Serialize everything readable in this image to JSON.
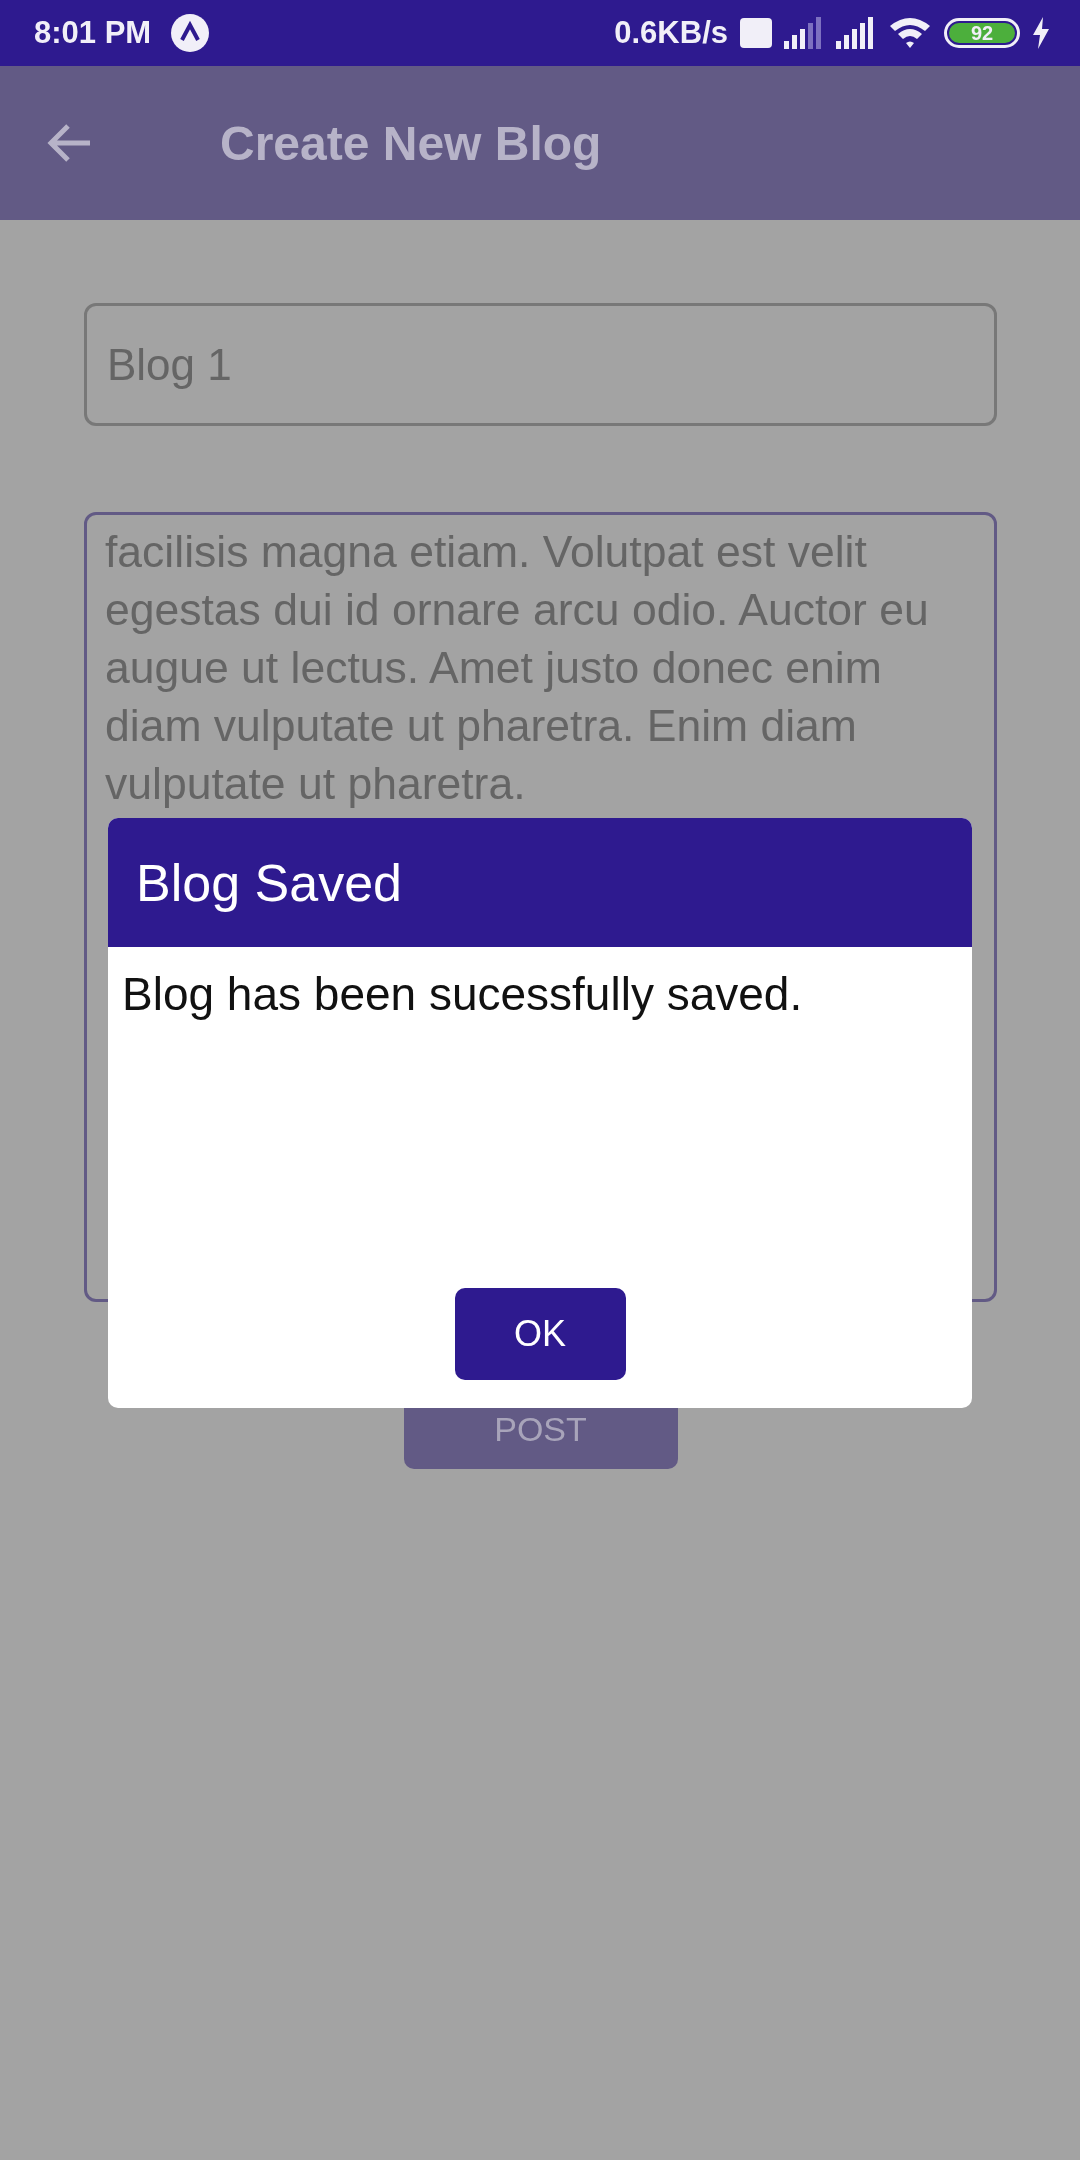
{
  "status_bar": {
    "time": "8:01 PM",
    "speed": "0.6KB/s",
    "battery": "92",
    "charging": true
  },
  "app_bar": {
    "title": "Create New Blog"
  },
  "title_field": {
    "value": "Blog 1"
  },
  "body_field": {
    "value": "facilisis magna etiam. Volutpat est velit egestas dui id ornare arcu odio. Auctor eu augue ut lectus. Amet justo donec enim diam vulputate ut pharetra. Enim diam vulputate ut pharetra."
  },
  "post_button": {
    "label": "POST"
  },
  "dialog": {
    "title": "Blog Saved",
    "message": "Blog has been sucessfully saved.",
    "button": "OK"
  }
}
